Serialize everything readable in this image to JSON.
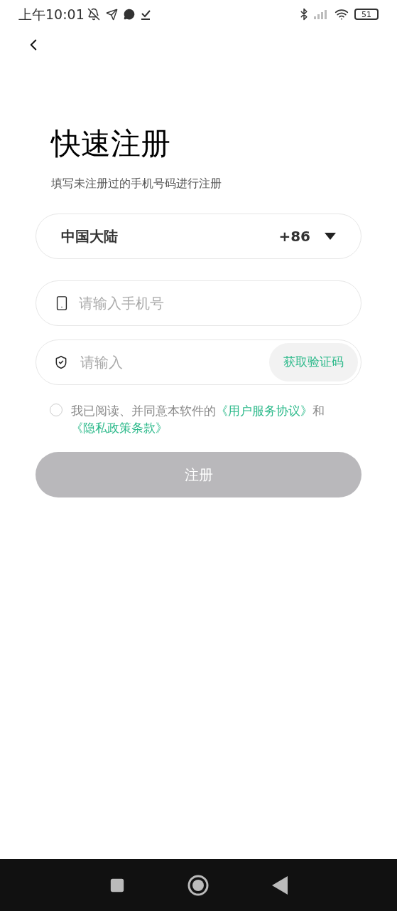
{
  "status_bar": {
    "time": "上午10:01",
    "battery": "51"
  },
  "title": "快速注册",
  "subtitle": "填写未注册过的手机号码进行注册",
  "region": {
    "name": "中国大陆",
    "code": "+86"
  },
  "phone_field": {
    "placeholder": "请输入手机号"
  },
  "code_field": {
    "placeholder": "请输入",
    "button": "获取验证码"
  },
  "agreement": {
    "checked": false,
    "text": "我已阅读、并同意本软件的",
    "link_1": "《用户服务协议》",
    "joiner": "和",
    "link_2": "《隐私政策条款》"
  },
  "register_button": {
    "label": "注册",
    "disabled": true
  }
}
